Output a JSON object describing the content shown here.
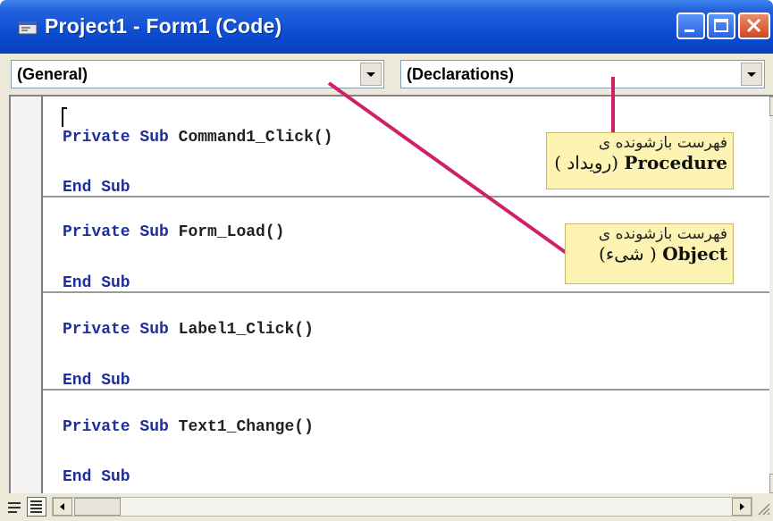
{
  "window": {
    "title": "Project1 - Form1 (Code)",
    "controls": [
      "minimize-icon",
      "maximize-icon",
      "close-icon"
    ]
  },
  "object_combo": {
    "value": "(General)"
  },
  "procedure_combo": {
    "value": "(Declarations)"
  },
  "code": {
    "procedures": [
      {
        "keywords": "Private Sub",
        "name": "Command1_Click()",
        "end": "End Sub"
      },
      {
        "keywords": "Private Sub",
        "name": "Form_Load()",
        "end": "End Sub"
      },
      {
        "keywords": "Private Sub",
        "name": "Label1_Click()",
        "end": "End Sub"
      },
      {
        "keywords": "Private Sub",
        "name": "Text1_Change()",
        "end": "End Sub"
      }
    ]
  },
  "annotations": {
    "procedure_list": {
      "line1": "فهرست بازشونده ی",
      "line2_en": "Procedure",
      "line2_fa": "(رویداد )"
    },
    "object_list": {
      "line1": "فهرست بازشونده ی",
      "line2_en": "Object",
      "line2_fa": "( شیء)"
    }
  },
  "colors": {
    "title_bar": "#0a46c8",
    "keyword": "#1d2f9a",
    "callout_bg": "#fdf3b2",
    "pointer_line": "#d0206a"
  }
}
